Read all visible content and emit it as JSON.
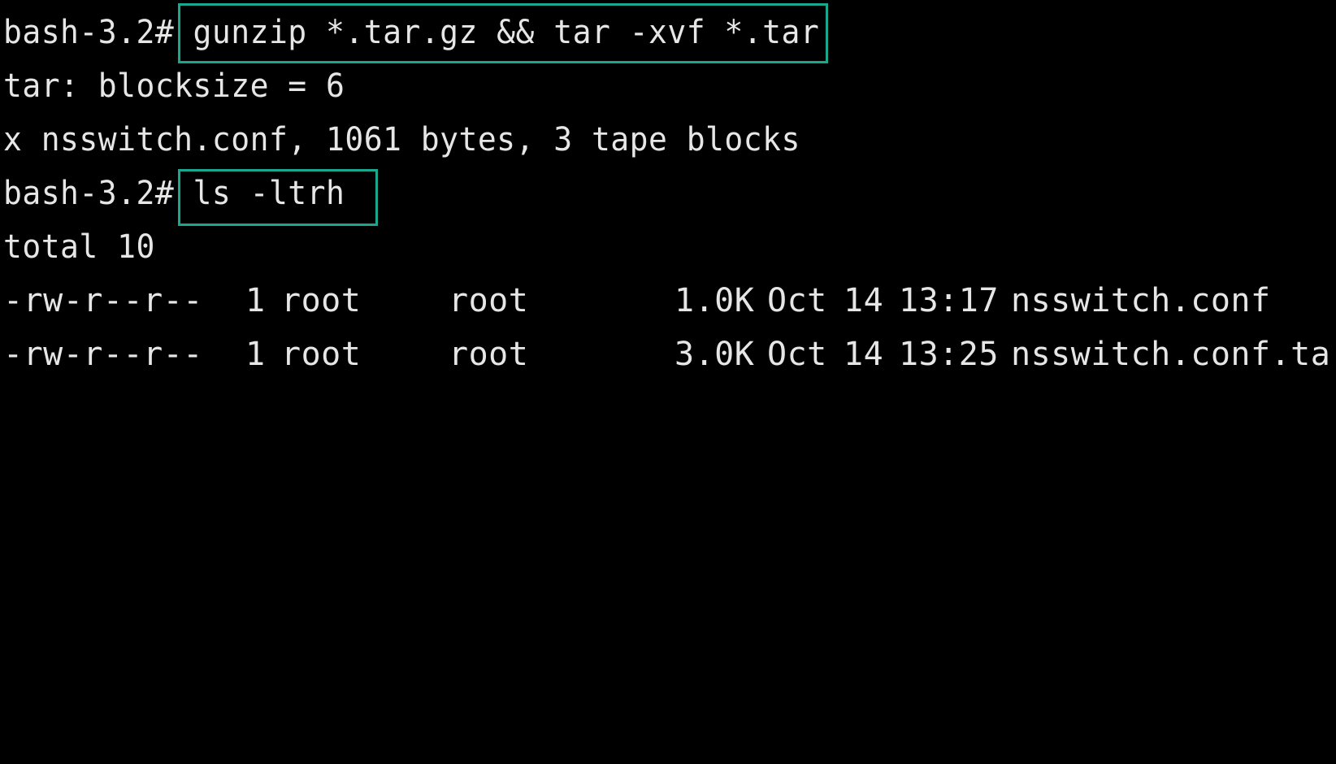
{
  "terminal": {
    "colors": {
      "background": "#000000",
      "foreground": "#e6e6e6",
      "highlight_box": "#1aa68f"
    },
    "lines": [
      {
        "prompt": "bash-3.2# ",
        "command": "gunzip *.tar.gz && tar -xvf *.tar"
      },
      {
        "text": "tar: blocksize = 6"
      },
      {
        "text": "x nsswitch.conf, 1061 bytes, 3 tape blocks"
      },
      {
        "prompt": "bash-3.2# ",
        "command": "ls -ltrh"
      },
      {
        "text": "total 10"
      }
    ],
    "listing": [
      {
        "perms": "-rw-r--r--",
        "links": "1",
        "owner": "root",
        "group": "root",
        "size": "1.0K",
        "month": "Oct",
        "day": "14",
        "time": "13:17",
        "name": "nsswitch.conf"
      },
      {
        "perms": "-rw-r--r--",
        "links": "1",
        "owner": "root",
        "group": "root",
        "size": "3.0K",
        "month": "Oct",
        "day": "14",
        "time": "13:25",
        "name": "nsswitch.conf.tar"
      }
    ]
  }
}
